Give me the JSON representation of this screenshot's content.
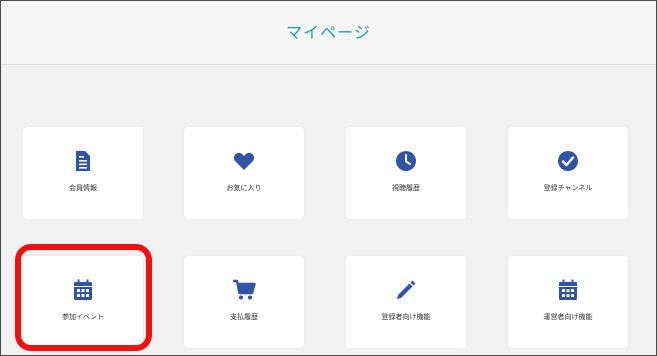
{
  "header": {
    "title": "マイページ"
  },
  "menu": {
    "items": [
      {
        "label": "会員情報",
        "icon": "document-icon"
      },
      {
        "label": "お気に入り",
        "icon": "heart-icon"
      },
      {
        "label": "視聴履歴",
        "icon": "clock-icon"
      },
      {
        "label": "登録チャンネル",
        "icon": "check-circle-icon"
      },
      {
        "label": "参加イベント",
        "icon": "calendar-icon"
      },
      {
        "label": "支払履歴",
        "icon": "cart-icon"
      },
      {
        "label": "登録者向け機能",
        "icon": "pencil-icon"
      },
      {
        "label": "運営者向け機能",
        "icon": "calendar-icon"
      }
    ]
  },
  "colors": {
    "icon": "#2f55a4",
    "title": "#17a7a8",
    "highlight": "#ee1111"
  }
}
